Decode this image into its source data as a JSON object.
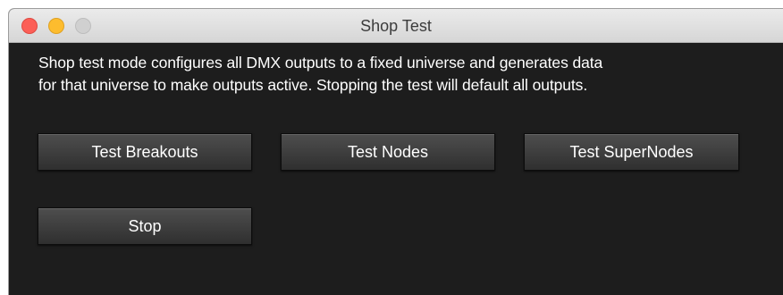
{
  "window": {
    "title": "Shop Test"
  },
  "description": {
    "line1": "Shop test mode configures all DMX outputs to a fixed universe and generates data",
    "line2": "for that universe to make outputs active.  Stopping the test will default all outputs."
  },
  "buttons": {
    "test_breakouts": "Test Breakouts",
    "test_nodes": "Test Nodes",
    "test_supernodes": "Test SuperNodes",
    "stop": "Stop"
  },
  "colors": {
    "background": "#1d1d1d",
    "close": "#fc5f57",
    "minimize": "#fdbc2e",
    "zoom_disabled": "#d0d0d0",
    "text": "#ffffff"
  }
}
